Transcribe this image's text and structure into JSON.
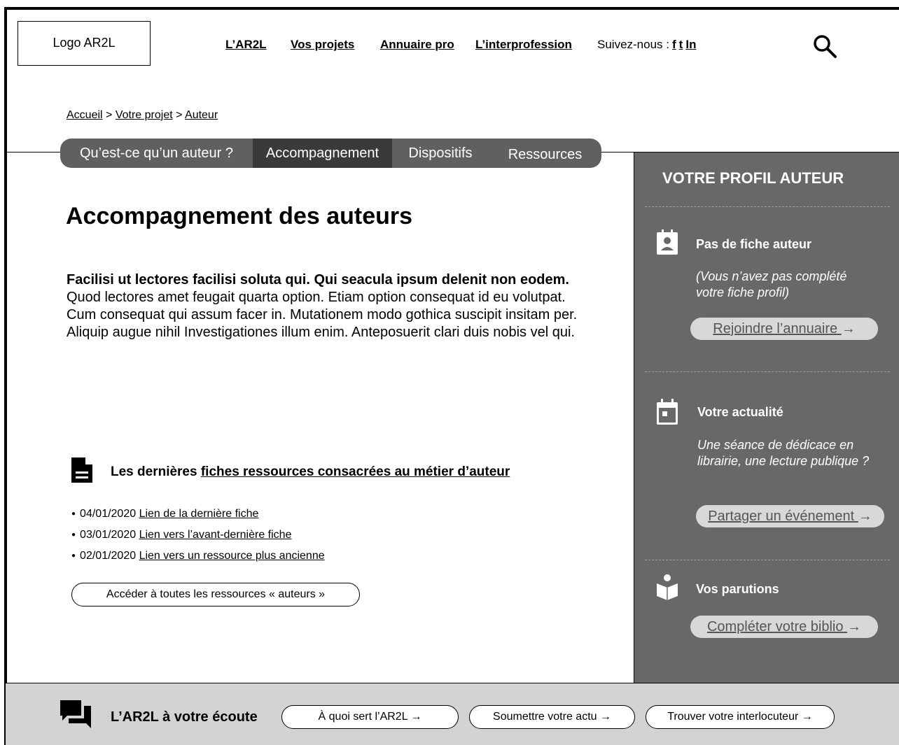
{
  "header": {
    "logo": "Logo AR2L",
    "nav": [
      "L’AR2L",
      "Vos projets",
      "Annuaire pro ",
      "L’interprofession"
    ],
    "follow_label": "Suivez-nous :",
    "social": [
      "f",
      "t",
      "In"
    ],
    "search_icon": "search-icon"
  },
  "breadcrumb": {
    "items": [
      "Accueil",
      "Votre projet",
      "Auteur"
    ],
    "separator": ">"
  },
  "tabs": [
    {
      "label": "Qu’est-ce qu’un auteur ?",
      "active": false
    },
    {
      "label": "Accompagnement",
      "active": true
    },
    {
      "label": "Dispositifs",
      "active": false
    },
    {
      "label": "Ressources",
      "active": false
    }
  ],
  "main": {
    "title": "Accompagnement des auteurs",
    "lead_bold": "Facilisi ut lectores facilisi soluta qui. Qui seacula ipsum delenit non eodem.",
    "lead_p1": "Quod lectores amet feugait quarta option. Etiam option consequat id eu volutpat. Cum consequat qui assum facer in. Mutationem modo gothica suscipit insitam per.",
    "lead_p2": "Aliquip augue nihil Investigationes illum enim. Anteposuerit clari duis nobis vel qui.",
    "resources": {
      "intro": "Les dernières ",
      "link": "fiches ressources consacrées au métier d’auteur",
      "items": [
        {
          "date": "04/01/2020",
          "link": "Lien de la dernière fiche"
        },
        {
          "date": "03/01/2020",
          "link": "Lien vers l’avant-dernière fiche"
        },
        {
          "date": "02/01/2020",
          "link": "Lien vers un ressource plus ancienne"
        }
      ],
      "all_button": "Accéder à toutes les ressources « auteurs »"
    }
  },
  "sidebar": {
    "title": "VOTRE PROFIL AUTEUR",
    "sections": [
      {
        "icon": "contact-card-icon",
        "heading": "Pas de fiche auteur",
        "text": "(Vous n’avez pas complété votre fiche profil)",
        "button": "Rejoindre l’annuaire "
      },
      {
        "icon": "calendar-icon",
        "heading": "Votre actualité",
        "text": "Une séance de dédicace en librairie, une lecture publique ?",
        "button": "Partager un événement "
      },
      {
        "icon": "book-reader-icon",
        "heading": "Vos parutions",
        "text": "",
        "button": "Compléter votre biblio "
      }
    ],
    "arrow": "→"
  },
  "footer": {
    "title": "L’AR2L à votre écoute",
    "buttons": [
      "À quoi sert l’AR2L →",
      "Soumettre votre actu →",
      "Trouver votre interlocuteur  →"
    ]
  },
  "colors": {
    "sidebar_bg": "#686868",
    "tabs_bg": "#606060",
    "tab_active": "#3a3a3a",
    "footer_bg": "#d3d3d3",
    "sidebar_button_bg": "#d8d8d8"
  }
}
